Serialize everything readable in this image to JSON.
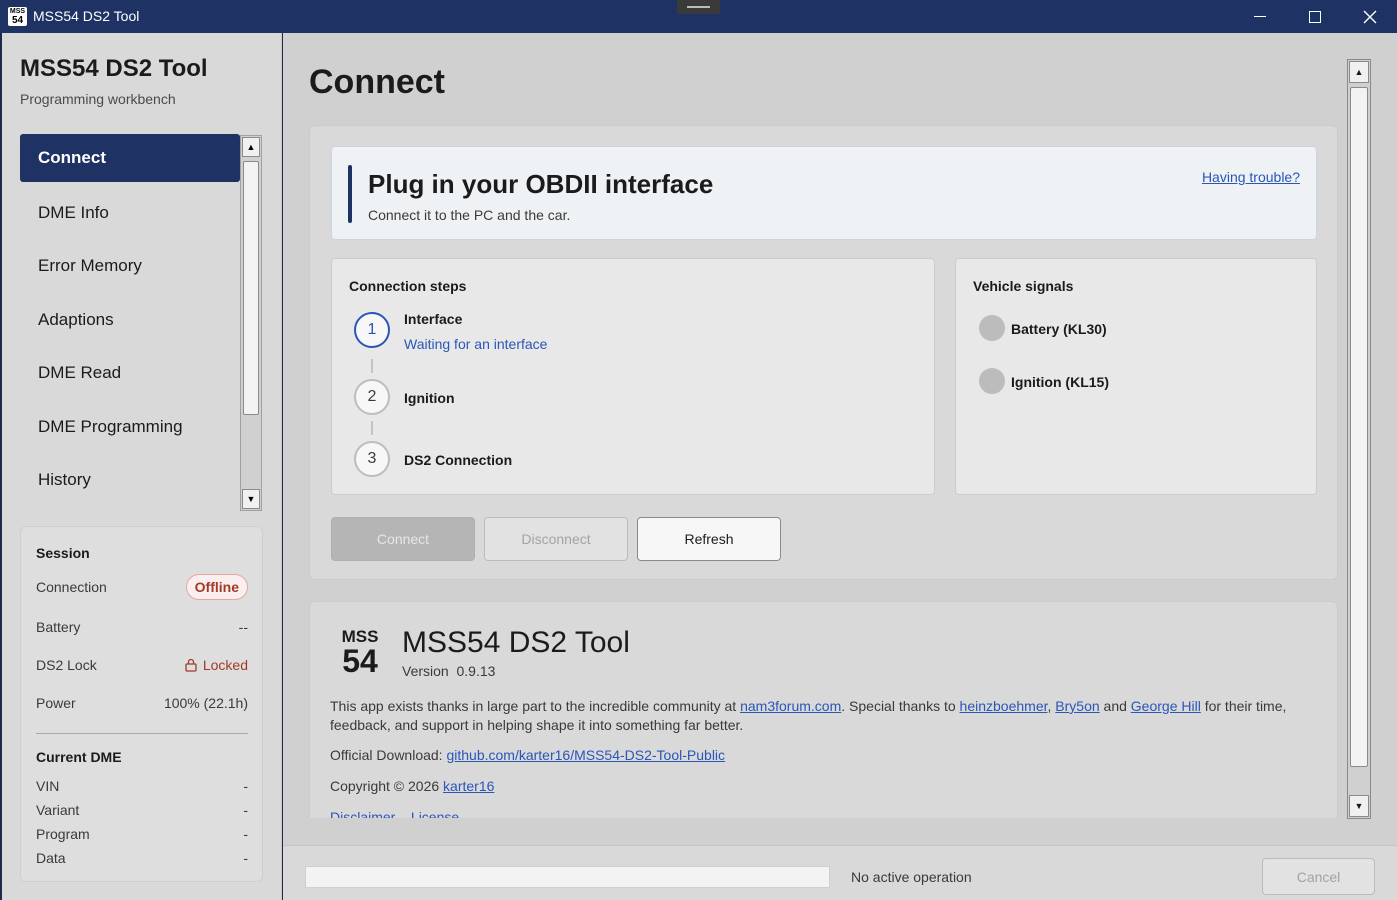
{
  "window": {
    "title": "MSS54 DS2 Tool",
    "icon_top": "MSS",
    "icon_bottom": "54"
  },
  "sidebar": {
    "app_title": "MSS54 DS2 Tool",
    "app_subtitle": "Programming workbench",
    "nav_items": [
      {
        "label": "Connect",
        "active": true
      },
      {
        "label": "DME Info"
      },
      {
        "label": "Error Memory"
      },
      {
        "label": "Adaptions"
      },
      {
        "label": "DME Read"
      },
      {
        "label": "DME Programming"
      },
      {
        "label": "History"
      }
    ],
    "session": {
      "heading": "Session",
      "connection_label": "Connection",
      "connection_value": "Offline",
      "battery_label": "Battery",
      "battery_value": "--",
      "lock_label": "DS2 Lock",
      "lock_value": "Locked",
      "power_label": "Power",
      "power_value": "100% (22.1h)"
    },
    "current_dme": {
      "heading": "Current DME",
      "rows": [
        {
          "label": "VIN",
          "value": "-"
        },
        {
          "label": "Variant",
          "value": "-"
        },
        {
          "label": "Program",
          "value": "-"
        },
        {
          "label": "Data",
          "value": "-"
        }
      ]
    }
  },
  "main": {
    "page_title": "Connect",
    "banner": {
      "title": "Plug in your OBDII interface",
      "subtitle": "Connect it to the PC and the car.",
      "help_link": "Having trouble?"
    },
    "steps": {
      "heading": "Connection steps",
      "items": [
        {
          "number": "1",
          "label": "Interface",
          "status": "Waiting for an interface",
          "active": true
        },
        {
          "number": "2",
          "label": "Ignition"
        },
        {
          "number": "3",
          "label": "DS2 Connection"
        }
      ]
    },
    "signals": {
      "heading": "Vehicle signals",
      "items": [
        {
          "label": "Battery (KL30)"
        },
        {
          "label": "Ignition (KL15)"
        }
      ]
    },
    "buttons": {
      "connect": "Connect",
      "disconnect": "Disconnect",
      "refresh": "Refresh"
    },
    "about": {
      "logo_top": "MSS",
      "logo_bottom": "54",
      "title": "MSS54 DS2 Tool",
      "version_label": "Version",
      "version": "0.9.13",
      "thanks_prefix": "This app exists thanks in large part to the incredible community at",
      "forum_link": "nam3forum.com",
      "thanks_mid": ". Special thanks to",
      "person1": "heinzboehmer",
      "person2": "Bry5on",
      "and_word": "and",
      "person3": "George Hill",
      "thanks_suffix": "for their time, feedback, and support in helping shape it into something far better.",
      "download_label": "Official Download:",
      "download_link": "github.com/karter16/MSS54-DS2-Tool-Public",
      "copyright": "Copyright © 2026",
      "author_link": "karter16",
      "disclaimer": "Disclaimer",
      "license": "License"
    }
  },
  "statusbar": {
    "progress": 0,
    "status_text": "No active operation",
    "cancel": "Cancel"
  },
  "colors": {
    "accent": "#1f3264",
    "link": "#2a56b8",
    "offline": "#a23a2a"
  }
}
